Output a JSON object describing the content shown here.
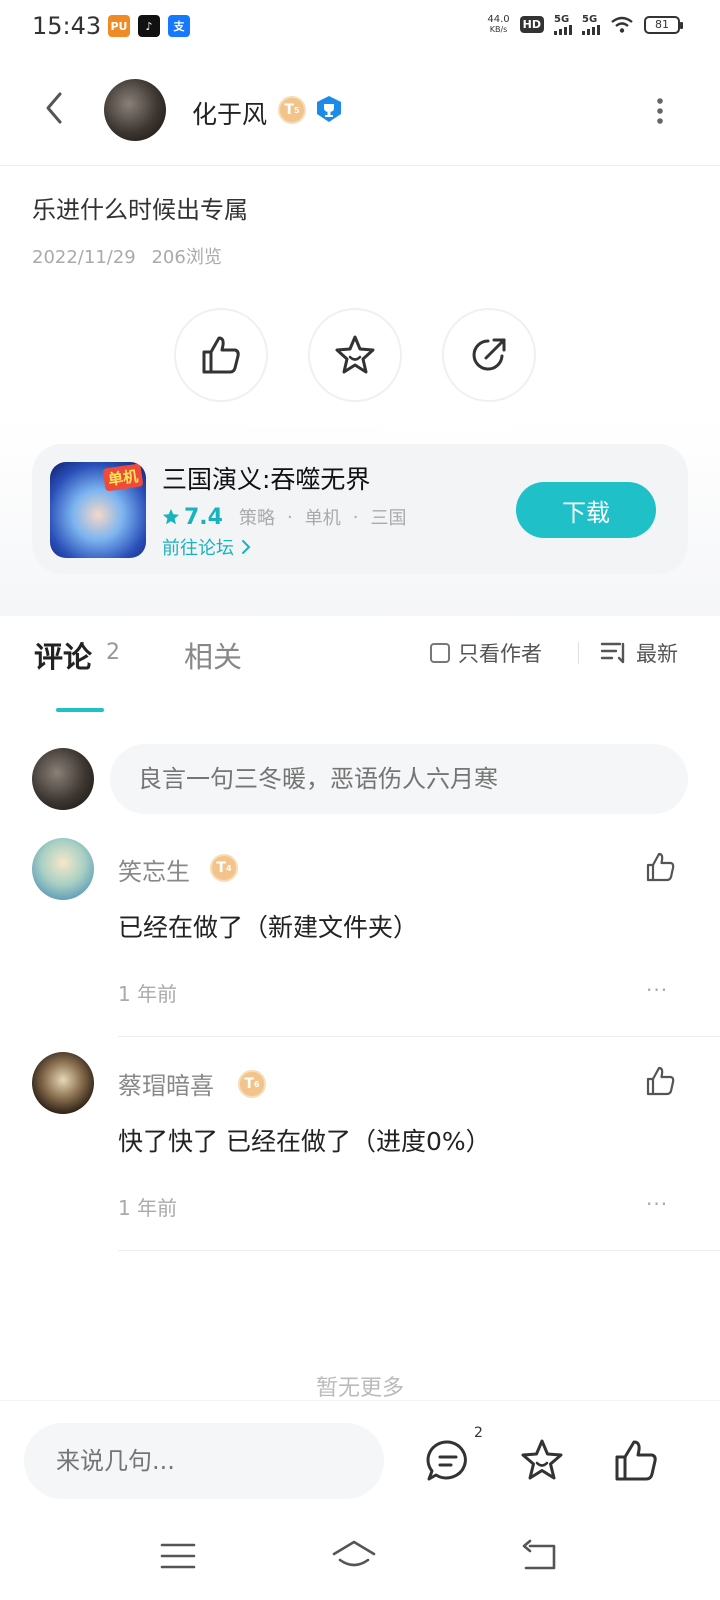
{
  "status_bar": {
    "time": "15:43",
    "net_speed_value": "44.0",
    "net_speed_unit": "KB/s",
    "hd_label": "HD",
    "sim1_label": "5G",
    "sim2_label": "5G",
    "battery": "81",
    "app_icons": [
      "pu-app-icon",
      "tiktok-icon",
      "alipay-icon"
    ]
  },
  "header": {
    "author_name": "化于风",
    "author_level": "T",
    "author_level_sub": "5"
  },
  "post": {
    "title": "乐进什么时候出专属",
    "date": "2022/11/29",
    "views": "206浏览"
  },
  "game": {
    "name": "三国演义:吞噬无界",
    "score": "7.4",
    "tags": [
      "策略",
      "单机",
      "三国"
    ],
    "icon_tag": "单机",
    "forum_link": "前往论坛",
    "download_label": "下载",
    "accent": "#20c0c8"
  },
  "tabs": {
    "comments_label": "评论",
    "comments_count": "2",
    "related_label": "相关",
    "only_author_label": "只看作者",
    "sort_label": "最新"
  },
  "comment_input": {
    "placeholder": "良言一句三冬暖，恶语伤人六月寒"
  },
  "comments": [
    {
      "name": "笑忘生",
      "level": "T",
      "level_sub": "4",
      "text": "已经在做了（新建文件夹）",
      "time": "1 年前",
      "more": "···"
    },
    {
      "name": "蔡瑁暗喜",
      "level": "T",
      "level_sub": "6",
      "text": "快了快了 已经在做了（进度0%）",
      "time": "1 年前",
      "more": "···"
    }
  ],
  "footer_note": "暂无更多",
  "bottom_bar": {
    "say_placeholder": "来说几句...",
    "comment_count": "2"
  }
}
